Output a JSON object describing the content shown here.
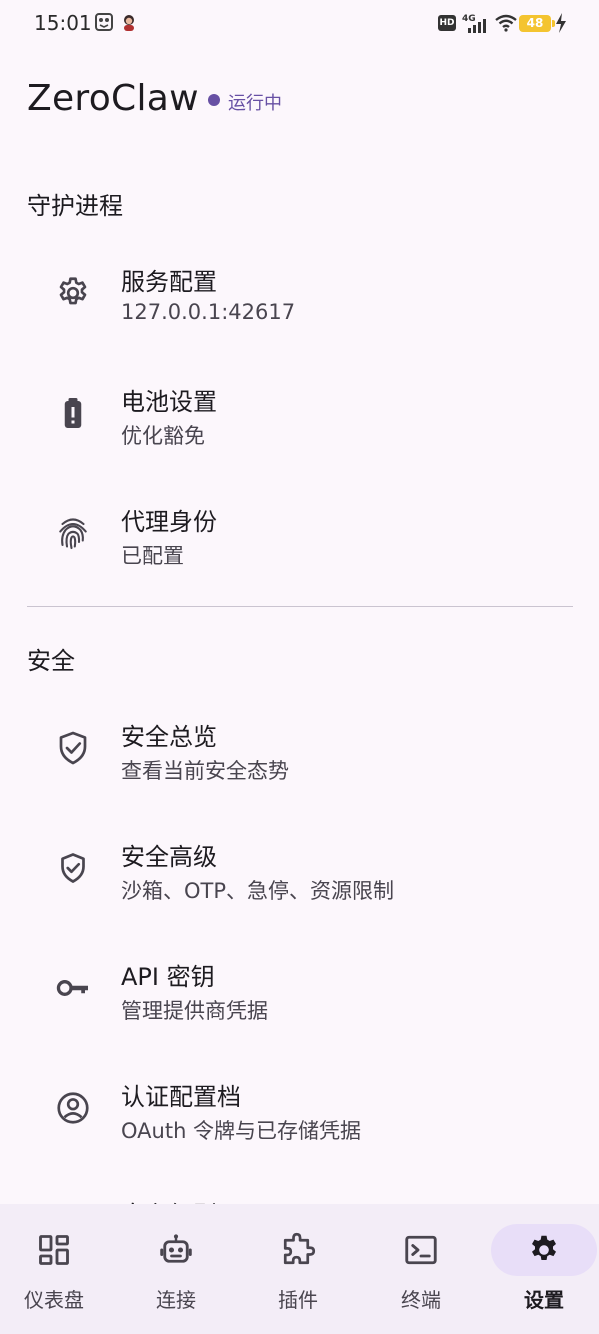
{
  "status_bar": {
    "time": "15:01",
    "hd_badge": "HD",
    "network": "4G",
    "battery": "48"
  },
  "header": {
    "title": "ZeroClaw",
    "status": "运行中"
  },
  "sections": [
    {
      "title": "守护进程",
      "items": [
        {
          "label": "服务配置",
          "sub": "127.0.0.1:42617",
          "icon": "gear-icon"
        },
        {
          "label": "电池设置",
          "sub": "优化豁免",
          "icon": "battery-alert-icon"
        },
        {
          "label": "代理身份",
          "sub": "已配置",
          "icon": "fingerprint-icon"
        }
      ]
    },
    {
      "title": "安全",
      "items": [
        {
          "label": "安全总览",
          "sub": "查看当前安全态势",
          "icon": "shield-check-icon"
        },
        {
          "label": "安全高级",
          "sub": "沙箱、OTP、急停、资源限制",
          "icon": "shield-check-icon"
        },
        {
          "label": "API 密钥",
          "sub": "管理提供商凭据",
          "icon": "key-icon"
        },
        {
          "label": "认证配置档",
          "sub": "OAuth 令牌与已存储凭据",
          "icon": "account-circle-icon"
        },
        {
          "label": "自主级别",
          "sub": "",
          "icon": ""
        }
      ]
    }
  ],
  "bottom_nav": {
    "items": [
      {
        "label": "仪表盘",
        "icon": "dashboard-icon"
      },
      {
        "label": "连接",
        "icon": "robot-icon"
      },
      {
        "label": "插件",
        "icon": "puzzle-icon"
      },
      {
        "label": "终端",
        "icon": "terminal-icon"
      },
      {
        "label": "设置",
        "icon": "gear-icon"
      }
    ],
    "active_index": 4
  },
  "colors": {
    "background": "#fcf7fc",
    "accent": "#6750a4",
    "nav_background": "#f3edf7",
    "nav_active_pill": "#e8def8"
  }
}
